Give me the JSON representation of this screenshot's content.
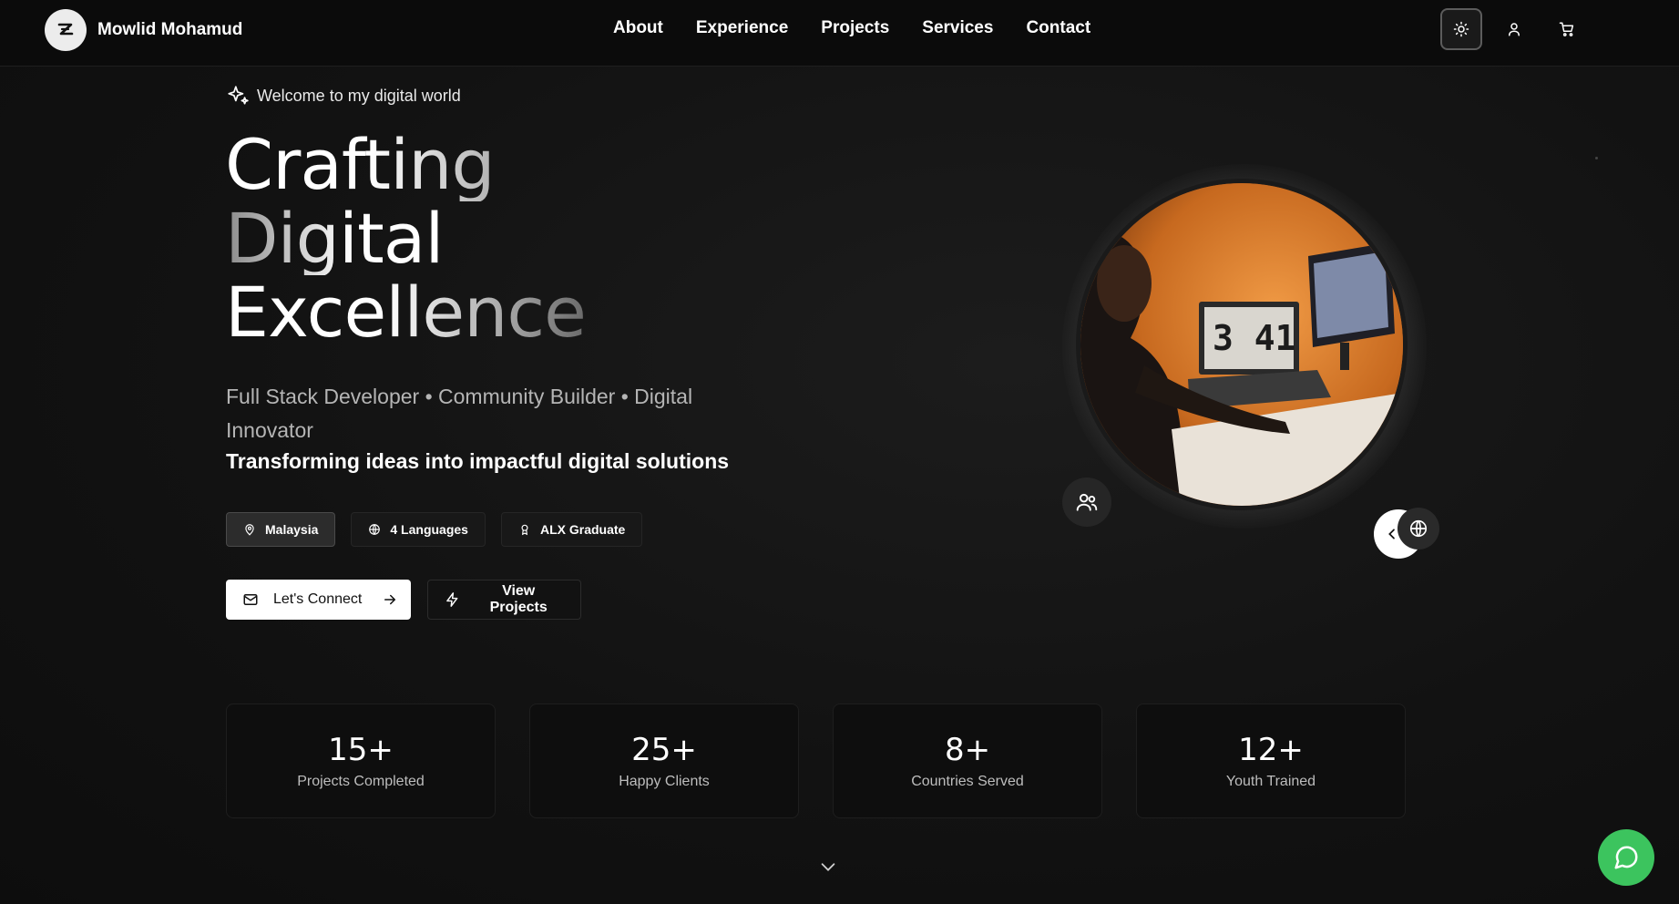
{
  "brand": {
    "name": "Mowlid Mohamud",
    "logo_icon": "z-logo-icon"
  },
  "nav": {
    "links": [
      "About",
      "Experience",
      "Projects",
      "Services",
      "Contact"
    ],
    "actions": [
      "sun-icon",
      "user-icon",
      "cart-icon"
    ]
  },
  "hero": {
    "welcome": "Welcome to my digital world",
    "headline": [
      "Crafting",
      "Digital",
      "Excellence"
    ],
    "subtitle": "Full Stack Developer • Community Builder • Digital Innovator",
    "tagline": "Transforming ideas into impactful digital solutions",
    "chips": [
      {
        "label": "Malaysia",
        "icon": "map-pin-icon"
      },
      {
        "label": "4 Languages",
        "icon": "globe-icon"
      },
      {
        "label": "ALX Graduate",
        "icon": "award-icon"
      }
    ],
    "cta_primary": "Let's Connect",
    "cta_secondary": "View Projects"
  },
  "portrait": {
    "screen_text": "3 41"
  },
  "stats": [
    {
      "value": "15+",
      "label": "Projects Completed"
    },
    {
      "value": "25+",
      "label": "Happy Clients"
    },
    {
      "value": "8+",
      "label": "Countries Served"
    },
    {
      "value": "12+",
      "label": "Youth Trained"
    }
  ],
  "colors": {
    "background": "#121212",
    "chat_button": "#3cc45e",
    "accent": "#ffffff"
  }
}
